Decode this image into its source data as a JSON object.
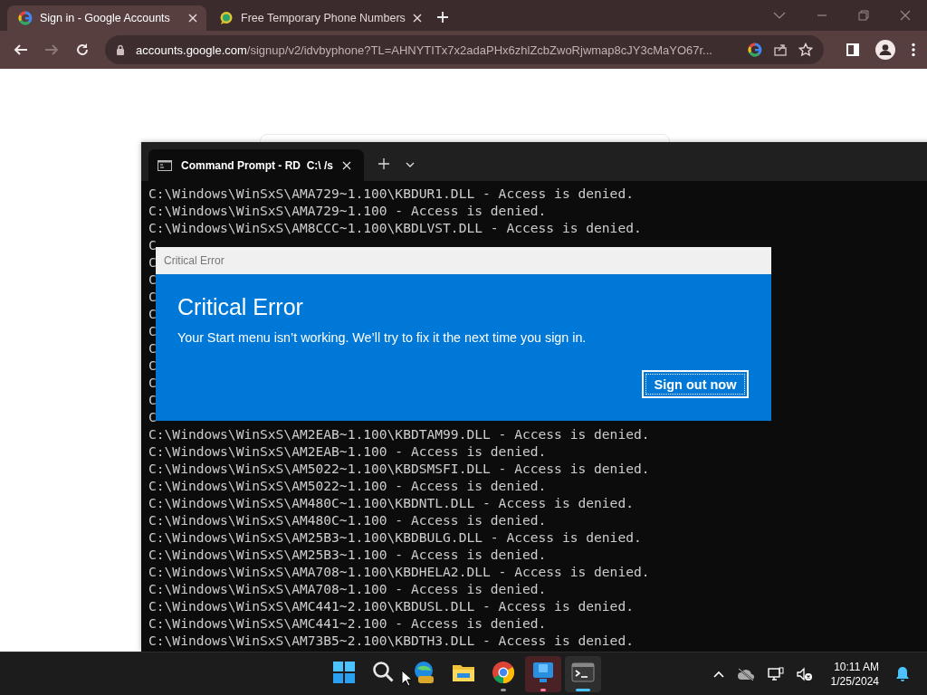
{
  "browser": {
    "tabs": [
      {
        "title": "Sign in - Google Accounts",
        "selected": true,
        "kind": "google"
      },
      {
        "title": "Free Temporary Phone Numbers",
        "selected": false,
        "kind": "chat"
      }
    ],
    "nav": [
      {
        "kind": "back",
        "disabled": false
      },
      {
        "kind": "forward",
        "disabled": true
      },
      {
        "kind": "reload",
        "disabled": false
      }
    ],
    "address": {
      "host": "accounts.google.com",
      "path": "/signup/v2/idvbyphone?TL=AHNYTITx7x2adaPHx6zhlZcbZwoRjwmap8cJY3cMaYO67r..."
    }
  },
  "terminal": {
    "tab_title": "Command Prompt - RD  C:\\ /s",
    "lines": [
      "C:\\Windows\\WinSxS\\AMA729~1.100\\KBDUR1.DLL - Access is denied.",
      "C:\\Windows\\WinSxS\\AMA729~1.100 - Access is denied.",
      "C:\\Windows\\WinSxS\\AM8CCC~1.100\\KBDLVST.DLL - Access is denied.",
      "C",
      "C",
      "C",
      "C",
      "C",
      "C",
      "C",
      "C",
      "C",
      "C",
      "C",
      "C:\\Windows\\WinSxS\\AM2EAB~1.100\\KBDTAM99.DLL - Access is denied.",
      "C:\\Windows\\WinSxS\\AM2EAB~1.100 - Access is denied.",
      "C:\\Windows\\WinSxS\\AM5022~1.100\\KBDSMSFI.DLL - Access is denied.",
      "C:\\Windows\\WinSxS\\AM5022~1.100 - Access is denied.",
      "C:\\Windows\\WinSxS\\AM480C~1.100\\KBDNTL.DLL - Access is denied.",
      "C:\\Windows\\WinSxS\\AM480C~1.100 - Access is denied.",
      "C:\\Windows\\WinSxS\\AM25B3~1.100\\KBDBULG.DLL - Access is denied.",
      "C:\\Windows\\WinSxS\\AM25B3~1.100 - Access is denied.",
      "C:\\Windows\\WinSxS\\AMA708~1.100\\KBDHELA2.DLL - Access is denied.",
      "C:\\Windows\\WinSxS\\AMA708~1.100 - Access is denied.",
      "C:\\Windows\\WinSxS\\AMC441~2.100\\KBDUSL.DLL - Access is denied.",
      "C:\\Windows\\WinSxS\\AMC441~2.100 - Access is denied.",
      "C:\\Windows\\WinSxS\\AM73B5~2.100\\KBDTH3.DLL - Access is denied."
    ]
  },
  "dialog": {
    "window_title": "Critical Error",
    "heading": "Critical Error",
    "message": "Your Start menu isn’t working. We’ll try to fix it the next time you sign in.",
    "button": "Sign out now"
  },
  "taskbar": {
    "apps": [
      {
        "kind": "start",
        "running": false,
        "attention": false,
        "selected": false
      },
      {
        "kind": "search",
        "running": false,
        "attention": false,
        "selected": false
      },
      {
        "kind": "edge",
        "running": false,
        "attention": false,
        "selected": false
      },
      {
        "kind": "files",
        "running": false,
        "attention": false,
        "selected": false
      },
      {
        "kind": "chrome",
        "running": true,
        "attention": false,
        "selected": false
      },
      {
        "kind": "remote",
        "running": true,
        "attention": true,
        "selected": false
      },
      {
        "kind": "terminal",
        "running": true,
        "attention": false,
        "selected": true
      }
    ],
    "time": "10:11 AM",
    "date": "1/25/2024"
  }
}
